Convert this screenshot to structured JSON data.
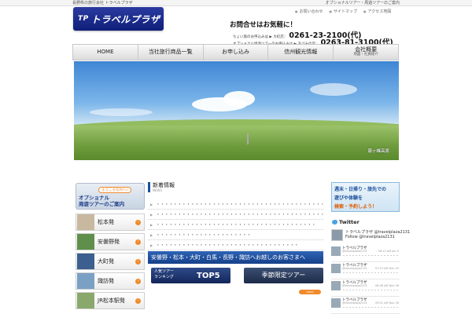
{
  "topbar": {
    "left_text": "長野県の旅行会社 トラベルプラザ",
    "right_text": "オプショナルツアー・周遊ツアーのご案内"
  },
  "header": {
    "logo_text": "トラベルプラザ",
    "logo_mark": "TP",
    "util_links": [
      "お問い合わせ",
      "サイトマップ",
      "アクセス地図"
    ],
    "contact_title": "お問合せはお気軽に！",
    "offices": [
      {
        "label": "ちょい旅のお申込みは ▶ 大町店：",
        "phone": "0261-23-2100(代)"
      },
      {
        "label": "オプショナル周遊ツアーのお申込みは ▶ あづみの店：",
        "phone": "0263-81-3100(代)"
      }
    ]
  },
  "nav": {
    "items": [
      "HOME",
      "当社旅行商品一覧",
      "お申し込み",
      "信州観光情報"
    ],
    "last_label": "会社概要",
    "last_sub": "地図・社員紹介"
  },
  "hero": {
    "caption": "霧ヶ峰高原"
  },
  "sidebar": {
    "welcome_badge": "ようこそ信州へ♪",
    "welcome_title": "オプショナル\n周遊ツアーのご案内",
    "items": [
      {
        "label": "松本発",
        "thumb": "#c9b8a0"
      },
      {
        "label": "安曇野発",
        "thumb": "#5f8f4a"
      },
      {
        "label": "大町発",
        "thumb": "#3b5f8e"
      },
      {
        "label": "諏訪発",
        "thumb": "#7aa0c4"
      },
      {
        "label": "JR松本駅発",
        "thumb": "#8aa86c"
      }
    ]
  },
  "news": {
    "title": "新着情報",
    "sub": "NEWS",
    "items": [
      "・・・・・・・・・・・・・・・・・・・・・・・・・・・・・・・・・・・・・・・",
      "・・・・・・・・・・・・・・・・・・・・・・・・・・・・・・・・・・・・・・・",
      "・・・・・・・・・・・・・・・・・・・・・・・・・・・・・・・・・・・・・",
      "・・・・・・・・・・・・・・・・・・・・・・",
      "・・・・・・・・・・・・・・・・・・・・・・・・・・・・・・・・・"
    ]
  },
  "banner": {
    "text": "安曇野・松本・大町・白馬・長野・諏訪へお越しのお客さまへ"
  },
  "promo": {
    "rank_line1": "人気ツアー",
    "rank_line2": "ランキング",
    "rank_big": "TOP5",
    "season": "季節限定ツアー",
    "more": "more"
  },
  "right_banner": {
    "line1": "週末・日帰り・旅先での",
    "line2": "遊びや体験を",
    "line3": "検索・予約しよう！"
  },
  "twitter": {
    "heading": "Twitter",
    "profile_name": "トラベルプラザ @travelplaza2131",
    "profile_follow": "Follow @travelplaza2131",
    "tweets": [
      {
        "name": "トラベルプラザ",
        "handle": "@travelplaza2131",
        "time": "06:13 AM Jan 5",
        "text": "・・・・・・・・・・・・・・・・・・ //tconatrx.. ・・"
      },
      {
        "name": "トラベルプラザ",
        "handle": "@travelplaza2131",
        "time": "07:23 AM Dec 25",
        "text": "・・・・・・・・・・・・・・・・・・・・・・・・・・・・"
      },
      {
        "name": "トラベルプラザ",
        "handle": "@travelplaza2131",
        "time": "08:46 AM Nov 28",
        "text": "・・・・・・・・・・・・・・・・・・・・・・・・・・・・"
      },
      {
        "name": "トラベルプラザ",
        "handle": "@travelplaza2131",
        "time": "09:01 AM Nov 28",
        "text": "・・・・・・・・・・・・・・・・・・・・・・・・・・・・"
      }
    ]
  }
}
